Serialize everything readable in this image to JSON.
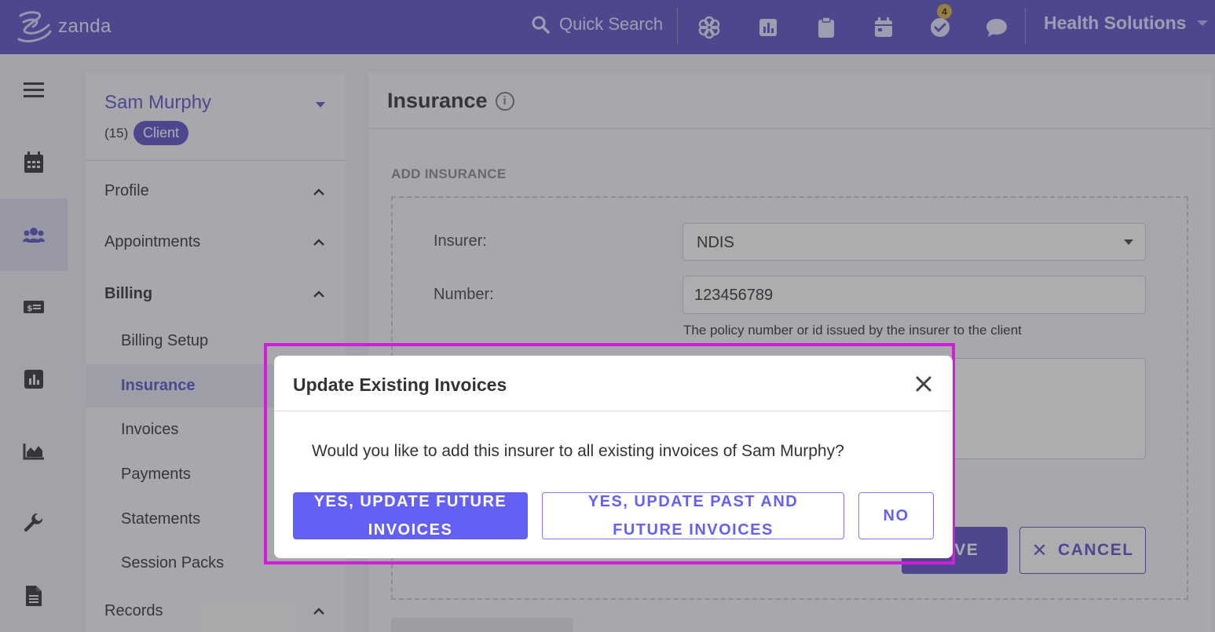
{
  "topbar": {
    "logo_text": "zanda",
    "quick_search": "Quick Search",
    "tasks_badge": "4",
    "org_name": "Health Solutions"
  },
  "client": {
    "name": "Sam Murphy",
    "count": "(15)",
    "type_badge": "Client"
  },
  "nav": {
    "profile": "Profile",
    "appointments": "Appointments",
    "billing": "Billing",
    "billing_items": [
      "Billing Setup",
      "Insurance",
      "Invoices",
      "Payments",
      "Statements",
      "Session Packs"
    ],
    "records": "Records"
  },
  "main": {
    "title": "Insurance",
    "info_icon": "i",
    "section": "ADD INSURANCE",
    "insurer_label": "Insurer:",
    "insurer_value": "NDIS",
    "number_label": "Number:",
    "number_value": "123456789",
    "number_help": "The policy number or id issued by the insurer to the client",
    "save_label": "SAVE",
    "cancel_label": "CANCEL"
  },
  "modal": {
    "title": "Update Existing Invoices",
    "message": "Would you like to add this insurer to all existing invoices of Sam Murphy?",
    "btn_future_line1": "YES, UPDATE FUTURE",
    "btn_future_line2": "INVOICES",
    "btn_past_line1": "YES, UPDATE PAST AND",
    "btn_past_line2": "FUTURE INVOICES",
    "btn_no": "NO"
  },
  "colors": {
    "brand": "#5b50c4",
    "modal_primary": "#6560f5",
    "highlight": "#d31ddc"
  }
}
